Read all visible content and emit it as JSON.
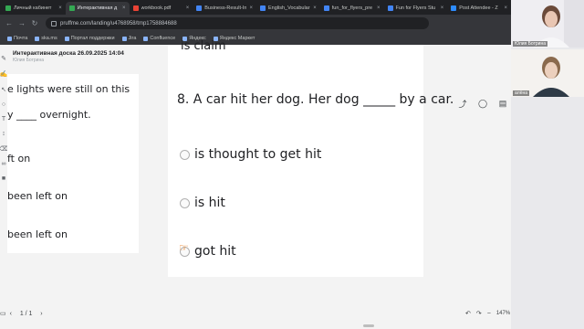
{
  "browser": {
    "tabs": [
      {
        "label": "Личный кабинет",
        "favicon_color": "#34a853",
        "active": false
      },
      {
        "label": "Интерактивная д",
        "favicon_color": "#34a853",
        "active": true
      },
      {
        "label": "workbook.pdf",
        "favicon_color": "#ea4335",
        "active": false
      },
      {
        "label": "Business-Result-In",
        "favicon_color": "#4285f4",
        "active": false
      },
      {
        "label": "English_Vocabular",
        "favicon_color": "#4285f4",
        "active": false
      },
      {
        "label": "fun_for_flyers_pre",
        "favicon_color": "#4285f4",
        "active": false
      },
      {
        "label": "Fun for Flyers Stu",
        "favicon_color": "#4285f4",
        "active": false
      },
      {
        "label": "Post Attendee - Z",
        "favicon_color": "#2d8cff",
        "active": false
      }
    ],
    "url": "pruffme.com/landing/u4768958/tmp1758884688",
    "bookmarks": [
      "Почта",
      "ska.ms",
      "Портал поддержки",
      "Jira",
      "Confluence",
      "Яндекс",
      "Яндекс Маркет"
    ]
  },
  "app": {
    "title": "Интерактивная доска 26.09.2025 14:04",
    "subtitle": "Юлия Ботрина"
  },
  "left_panel": {
    "lines": [
      "e lights were still on this",
      "y ____ overnight.",
      "ft on",
      "been left on",
      "been left on"
    ]
  },
  "card": {
    "partial_text": "is claim",
    "question": "8. A car hit her dog. Her dog _____ by a car.",
    "options": [
      "is thought to get hit",
      "is hit",
      "got hit"
    ]
  },
  "bottom": {
    "page_indicator": "1 / 1",
    "zoom": "147%"
  },
  "video": {
    "participants": [
      {
        "name": "Юлия Ботрина"
      },
      {
        "name": "алёна"
      }
    ]
  },
  "colors": {
    "accent": "#e8710a",
    "chrome_dark": "#202124",
    "chrome": "#35363a"
  }
}
